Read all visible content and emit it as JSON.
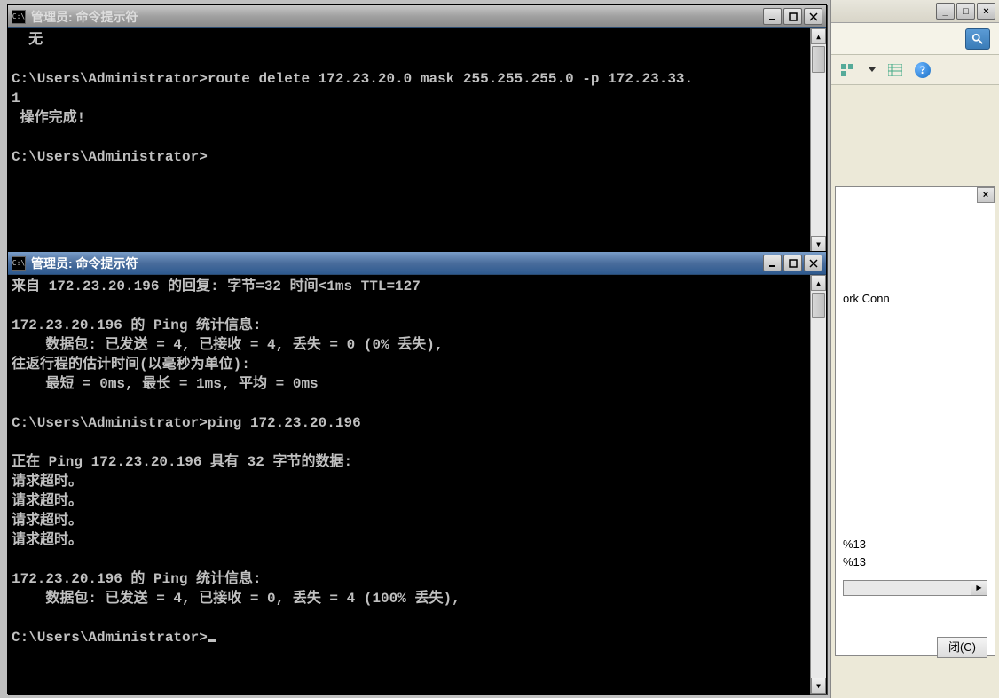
{
  "bg_window": {
    "win_controls": {
      "min": "_",
      "max": "□",
      "close": "×"
    },
    "panel_close": "×",
    "connection_label": "ork Conn",
    "status_lines": [
      "%13",
      "%13"
    ],
    "scroll_right": "▶",
    "close_button_label": "闭(C)"
  },
  "cmd1": {
    "title": "管理员: 命令提示符",
    "icon_text": "C:\\",
    "lines": [
      "  无",
      "",
      "C:\\Users\\Administrator>route delete 172.23.20.0 mask 255.255.255.0 -p 172.23.33.",
      "1",
      " 操作完成!",
      "",
      "C:\\Users\\Administrator>",
      ""
    ]
  },
  "cmd2": {
    "title": "管理员: 命令提示符",
    "icon_text": "C:\\",
    "lines": [
      "来自 172.23.20.196 的回复: 字节=32 时间<1ms TTL=127",
      "",
      "172.23.20.196 的 Ping 统计信息:",
      "    数据包: 已发送 = 4, 已接收 = 4, 丢失 = 0 (0% 丢失),",
      "往返行程的估计时间(以毫秒为单位):",
      "    最短 = 0ms, 最长 = 1ms, 平均 = 0ms",
      "",
      "C:\\Users\\Administrator>ping 172.23.20.196",
      "",
      "正在 Ping 172.23.20.196 具有 32 字节的数据:",
      "请求超时。",
      "请求超时。",
      "请求超时。",
      "请求超时。",
      "",
      "172.23.20.196 的 Ping 统计信息:",
      "    数据包: 已发送 = 4, 已接收 = 0, 丢失 = 4 (100% 丢失),",
      "",
      "C:\\Users\\Administrator>_"
    ],
    "prompt_with_cursor": "C:\\Users\\Administrator>"
  }
}
